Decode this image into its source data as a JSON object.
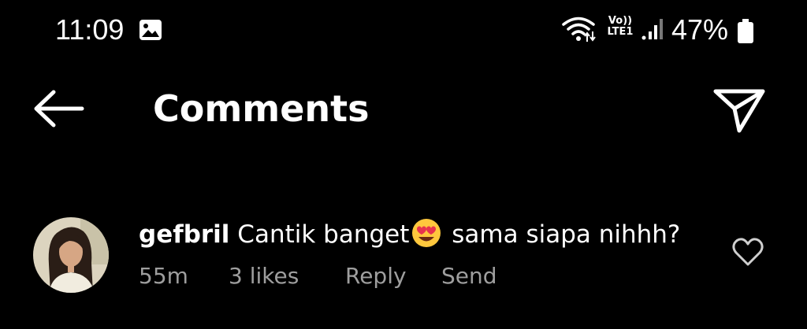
{
  "status_bar": {
    "time": "11:09",
    "network_label_top": "Vo))",
    "network_label_bottom": "LTE1",
    "battery_percent": "47%",
    "icons": [
      "gallery-icon",
      "wifi-icon",
      "lte-icon",
      "signal-icon",
      "battery-icon"
    ]
  },
  "header": {
    "title": "Comments",
    "back_icon": "back-arrow-icon",
    "share_icon": "send-icon"
  },
  "comment": {
    "username": "gefbril",
    "text_before_emoji": "Cantik banget",
    "emoji": "smiling-face-with-heart-eyes",
    "text_after_emoji": "sama siapa nihhh?",
    "time_ago": "55m",
    "likes": "3 likes",
    "reply_label": "Reply",
    "send_label": "Send",
    "like_icon": "heart-outline-icon"
  },
  "colors": {
    "background": "#000000",
    "text": "#ffffff",
    "meta_text": "#9e9e9e",
    "emoji_yellow": "#FFC83D",
    "emoji_hearts": "#E8344E"
  }
}
